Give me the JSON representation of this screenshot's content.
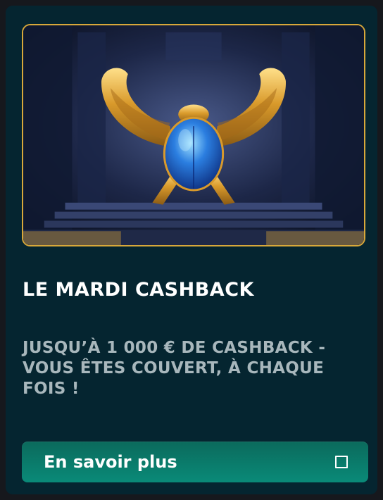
{
  "promo": {
    "title": "LE MARDI CASHBACK",
    "description": "JUSQU’À 1 000 € DE CASHBACK - VOUS ÊTES COUVERT, À CHAQUE FOIS !",
    "cta_label": "En savoir plus",
    "cta_icon": "square-icon",
    "image_icon": "scarab-icon"
  },
  "colors": {
    "card_bg": "#052530",
    "accent_gold": "#d8a83a",
    "button_teal": "#0a8a78",
    "title": "#ffffff",
    "description": "#a8b7bc"
  }
}
